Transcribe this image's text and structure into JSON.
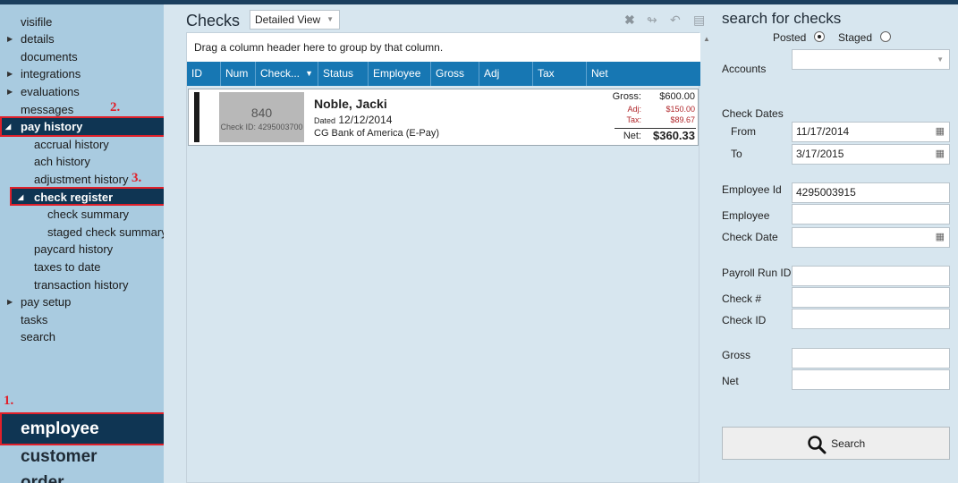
{
  "sidebar": {
    "items": [
      {
        "label": "visifile",
        "expandable": false
      },
      {
        "label": "details",
        "expandable": true
      },
      {
        "label": "documents",
        "expandable": false
      },
      {
        "label": "integrations",
        "expandable": true
      },
      {
        "label": "evaluations",
        "expandable": true
      },
      {
        "label": "messages",
        "expandable": false
      },
      {
        "label": "pay history",
        "expandable": true,
        "expanded": true,
        "selected": true
      },
      {
        "label": "accrual history"
      },
      {
        "label": "ach history"
      },
      {
        "label": "adjustment history"
      },
      {
        "label": "check register",
        "expandable": true,
        "expanded": true,
        "selected": true
      },
      {
        "label": "check summary"
      },
      {
        "label": "staged check summary"
      },
      {
        "label": "paycard history"
      },
      {
        "label": "taxes to date"
      },
      {
        "label": "transaction history"
      },
      {
        "label": "pay setup",
        "expandable": true
      },
      {
        "label": "tasks"
      },
      {
        "label": "search"
      }
    ],
    "annotations": [
      "1.",
      "2.",
      "3."
    ],
    "sections": [
      {
        "label": "employee",
        "selected": true
      },
      {
        "label": "customer"
      },
      {
        "label": "order"
      }
    ]
  },
  "main": {
    "title": "Checks",
    "view_select": "Detailed View",
    "group_hint": "Drag a column header here to group by that column.",
    "columns": [
      "ID",
      "Num",
      "Check...",
      "Status",
      "Employee",
      "Gross",
      "Adj",
      "Tax",
      "Net"
    ],
    "check": {
      "number": "840",
      "check_id": "Check ID: 4295003700",
      "employee": "Noble, Jacki",
      "dated_label": "Dated",
      "dated": "12/12/2014",
      "bank": "CG Bank of America (E-Pay)",
      "gross_label": "Gross:",
      "gross": "$600.00",
      "adj_label": "Adj:",
      "adj": "$150.00",
      "tax_label": "Tax:",
      "tax": "$89.67",
      "net_label": "Net:",
      "net": "$360.33"
    }
  },
  "search": {
    "title": "search for checks",
    "posted_label": "Posted",
    "staged_label": "Staged",
    "posted_selected": true,
    "fields": {
      "accounts": {
        "label": "Accounts",
        "value": ""
      },
      "check_dates": {
        "label": "Check Dates"
      },
      "from": {
        "label": "From",
        "value": "11/17/2014"
      },
      "to": {
        "label": "To",
        "value": "3/17/2015"
      },
      "employee_id": {
        "label": "Employee Id",
        "value": "4295003915"
      },
      "employee": {
        "label": "Employee",
        "value": ""
      },
      "check_date": {
        "label": "Check Date",
        "value": ""
      },
      "payroll_run_id": {
        "label": "Payroll Run ID",
        "value": ""
      },
      "check_num": {
        "label": "Check #",
        "value": ""
      },
      "check_id": {
        "label": "Check ID",
        "value": ""
      },
      "gross": {
        "label": "Gross",
        "value": ""
      },
      "net": {
        "label": "Net",
        "value": ""
      }
    },
    "button_label": "Search"
  },
  "colors": {
    "sidebar_bg": "#a9cbe0",
    "nav_selected": "#0f3553",
    "header_blue": "#1777b3",
    "annotation_red": "#e0202a",
    "panel_bg": "#d7e6ef"
  }
}
